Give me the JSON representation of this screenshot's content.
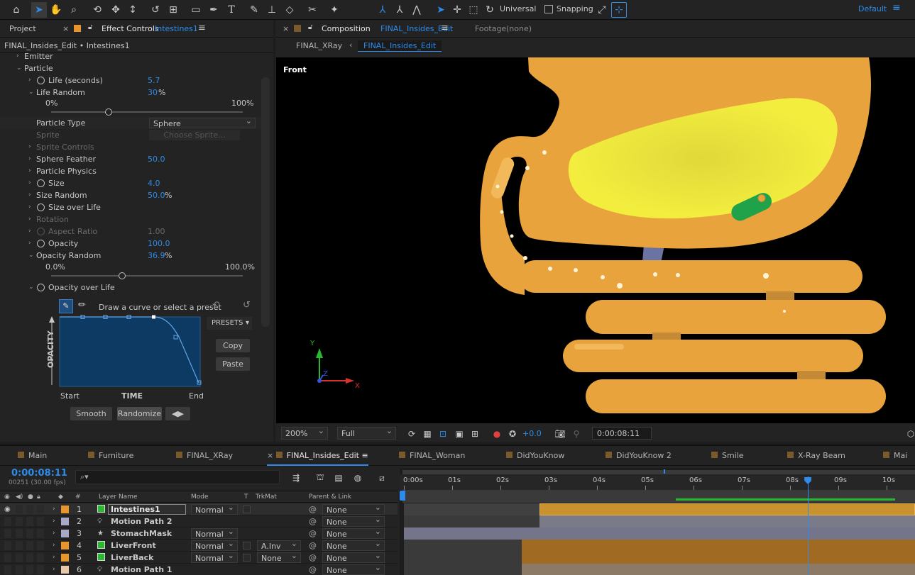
{
  "toolbar": {
    "tools": [
      "home-icon",
      "selection-arrow-icon",
      "hand-icon",
      "zoom-icon",
      "rotate-camera-icon",
      "pan-icon",
      "dolly-icon",
      "rotation-icon",
      "pan-behind-icon",
      "rectangle-icon",
      "pen-icon",
      "type-icon",
      "brush-icon",
      "clone-stamp-icon",
      "eraser-icon",
      "roto-brush-icon",
      "puppet-pin-icon"
    ],
    "axis_mode": "Universal",
    "snapping_label": "Snapping",
    "workspace": "Default"
  },
  "left_panel": {
    "tab_project": "Project",
    "tab_effect_controls": "Effect Controls",
    "effect_layer": "Intestines1",
    "breadcrumb": "FINAL_Insides_Edit • Intestines1",
    "rows": [
      {
        "label": "Emitter"
      },
      {
        "label": "Particle"
      },
      {
        "label": "Life (seconds)",
        "value": "5.7"
      },
      {
        "label": "Life Random",
        "value": "30",
        "unit": "%"
      },
      {
        "label": "Particle Type",
        "value": "Sphere"
      },
      {
        "label": "Sprite",
        "value": "Choose Sprite..."
      },
      {
        "label": "Sprite Controls"
      },
      {
        "label": "Sphere Feather",
        "value": "50.0"
      },
      {
        "label": "Particle Physics"
      },
      {
        "label": "Size",
        "value": "4.0"
      },
      {
        "label": "Size Random",
        "value": "50.0",
        "unit": "%"
      },
      {
        "label": "Size over Life"
      },
      {
        "label": "Rotation"
      },
      {
        "label": "Aspect Ratio",
        "value": "1.00"
      },
      {
        "label": "Opacity",
        "value": "100.0"
      },
      {
        "label": "Opacity Random",
        "value": "36.9",
        "unit": "%"
      },
      {
        "label": "Opacity over Life"
      }
    ],
    "life_random_slider": {
      "min": "0%",
      "max": "100%",
      "level": 0.3
    },
    "opacity_random_slider": {
      "min": "0.0%",
      "max": "100.0%",
      "level": 0.369
    },
    "curve": {
      "hint": "Draw a curve or select a preset",
      "presets": "PRESETS",
      "y_label": "OPACITY",
      "x_label": "TIME",
      "start": "Start",
      "end": "End",
      "copy": "Copy",
      "paste": "Paste",
      "smooth": "Smooth",
      "randomize": "Randomize"
    }
  },
  "comp_panel": {
    "tab_label": "Composition",
    "comp_name": "FINAL_Insides_Edit",
    "footage_tab": "Footage",
    "footage_value": "(none)",
    "nav_prev": "FINAL_XRay",
    "nav_current": "FINAL_Insides_Edit",
    "view_label": "Front",
    "axis_labels": {
      "y": "Y",
      "z": "Z",
      "x": "X"
    },
    "zoom": "200%",
    "resolution": "Full",
    "exposure": "+0.0",
    "timecode": "0:00:08:11",
    "colors": {
      "organ": "#e8a33c",
      "highlight": "#f3ee3e",
      "pill": "#1fa24a",
      "vessel": "#6b73a3"
    }
  },
  "timeline": {
    "tabs": [
      {
        "label": "Main",
        "color": "#7a5a2a"
      },
      {
        "label": "Furniture",
        "color": "#7a5a2a"
      },
      {
        "label": "FINAL_XRay",
        "color": "#7a5a2a"
      },
      {
        "label": "FINAL_Insides_Edit",
        "color": "#7a5a2a",
        "active": true
      },
      {
        "label": "FINAL_Woman",
        "color": "#7a5a2a"
      },
      {
        "label": "DidYouKnow",
        "color": "#7a5a2a"
      },
      {
        "label": "DidYouKnow 2",
        "color": "#7a5a2a"
      },
      {
        "label": "Smile",
        "color": "#7a5a2a"
      },
      {
        "label": "X-Ray Beam",
        "color": "#7a5a2a"
      },
      {
        "label": "Mai",
        "color": "#7a5a2a"
      }
    ],
    "timecode": "0:00:08:11",
    "frame_info": "00251 (30.00 fps)",
    "search_placeholder": "",
    "columns": {
      "hash": "#",
      "layer_name": "Layer Name",
      "mode": "Mode",
      "t": "T",
      "trkmat": "TrkMat",
      "parent": "Parent & Link"
    },
    "ruler": [
      "0:00s",
      "01s",
      "02s",
      "03s",
      "04s",
      "05s",
      "06s",
      "07s",
      "08s",
      "09s",
      "10s"
    ],
    "playhead_seconds": 8.37,
    "layers": [
      {
        "num": "1",
        "name": "Intestines1",
        "label_color": "#e8952c",
        "icon": "solid-green",
        "mode": "Normal",
        "trkmat": "",
        "parent": "None",
        "selected": true
      },
      {
        "num": "2",
        "name": "Motion Path 2",
        "label_color": "#a8a8c8",
        "icon": "bulb",
        "mode": "",
        "trkmat": "",
        "parent": "None"
      },
      {
        "num": "3",
        "name": "StomachMask",
        "label_color": "#a8a8c8",
        "icon": "star",
        "mode": "Normal",
        "trkmat": "",
        "parent": "None"
      },
      {
        "num": "4",
        "name": "LiverFront",
        "label_color": "#e8952c",
        "icon": "solid-green",
        "mode": "Normal",
        "trkmat": "A.Inv",
        "parent": "None"
      },
      {
        "num": "5",
        "name": "LiverBack",
        "label_color": "#e8952c",
        "icon": "solid-green",
        "mode": "Normal",
        "trkmat": "None",
        "parent": "None"
      },
      {
        "num": "6",
        "name": "Motion Path 1",
        "label_color": "#e8c8a8",
        "icon": "bulb",
        "mode": "",
        "trkmat": "",
        "parent": "None"
      }
    ]
  }
}
